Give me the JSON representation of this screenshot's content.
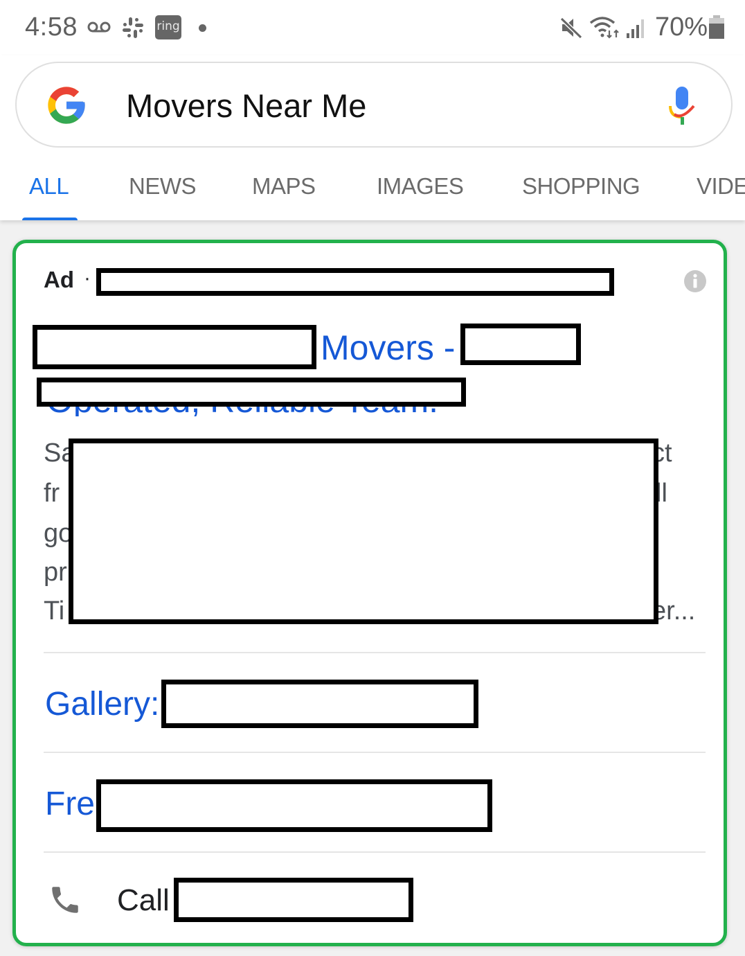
{
  "status_bar": {
    "time": "4:58",
    "battery_percent": "70%",
    "ring_label": "ring",
    "icons": [
      "voicemail-icon",
      "slack-icon",
      "ring-app-icon",
      "notification-dot",
      "mute-icon",
      "wifi-icon",
      "signal-icon",
      "battery-icon"
    ]
  },
  "search": {
    "query": "Movers Near Me",
    "logo": "google-g-logo",
    "mic": "voice-search-icon"
  },
  "tabs": [
    {
      "label": "ALL",
      "active": true
    },
    {
      "label": "NEWS",
      "active": false
    },
    {
      "label": "MAPS",
      "active": false
    },
    {
      "label": "IMAGES",
      "active": false
    },
    {
      "label": "SHOPPING",
      "active": false
    },
    {
      "label": "VIDE",
      "active": false
    }
  ],
  "ad": {
    "ad_label": "Ad",
    "separator": "·",
    "title_visible": "Movers -",
    "title_line2_partial": "Operated, Reliable Team.",
    "description_fragments": {
      "line1_start": "Sa",
      "line1_end": "ct",
      "line2_start": "fr",
      "line2_end": "ll",
      "line3_start": "go",
      "line4_start": "pr",
      "line5_start": "Ti",
      "line5_end": "er..."
    },
    "sitelinks": [
      {
        "label": "Gallery:"
      },
      {
        "label": "Fre"
      }
    ],
    "call_label": "Call",
    "border_color": "#22b14c",
    "link_color": "#1558d6"
  }
}
